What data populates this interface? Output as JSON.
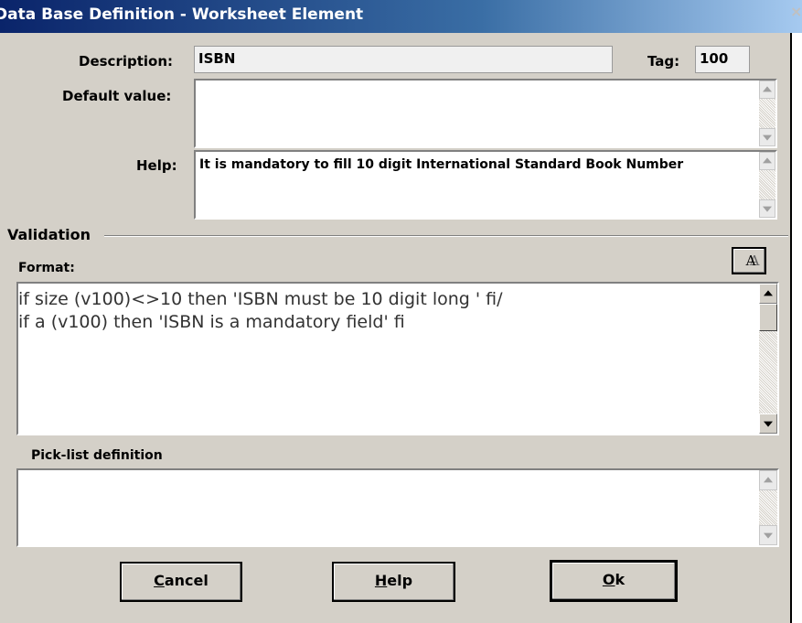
{
  "window": {
    "title": "Data Base Definition - Worksheet Element",
    "close_glyph": "×"
  },
  "fields": {
    "description_label": "Description:",
    "description_value": "ISBN",
    "tag_label": "Tag:",
    "tag_value": "100",
    "default_label": "Default value:",
    "default_value": "",
    "help_label": "Help:",
    "help_value": "It is mandatory to fill 10 digit International Standard Book Number"
  },
  "validation": {
    "group_label": "Validation",
    "format_label": "Format:",
    "font_button_glyph": "A",
    "format_lines": [
      "if size (v100)<>10 then 'ISBN must be 10 digit long ' fi/",
      "if a (v100) then 'ISBN is a mandatory field' fi"
    ],
    "picklist_label": "Pick-list definition",
    "picklist_value": ""
  },
  "buttons": {
    "cancel": {
      "first": "C",
      "rest": "ancel"
    },
    "help": {
      "first": "H",
      "rest": "elp"
    },
    "ok": {
      "first": "O",
      "rest": "k"
    }
  },
  "icons": {
    "font": "font-icon",
    "up": "arrow-up-icon",
    "down": "arrow-down-icon",
    "close": "close-icon"
  }
}
